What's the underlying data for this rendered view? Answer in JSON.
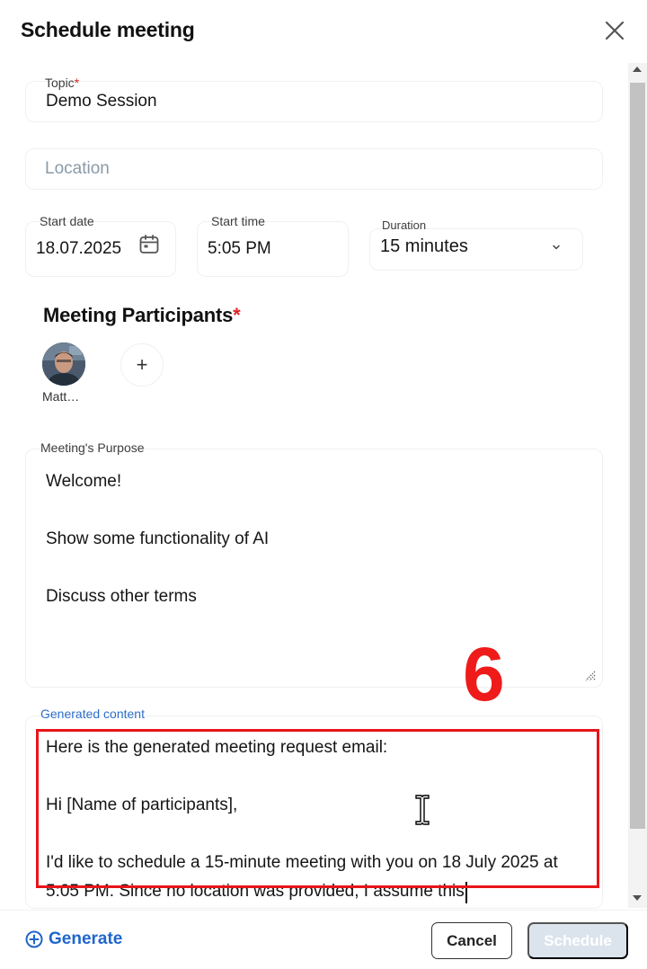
{
  "dialog": {
    "title": "Schedule meeting"
  },
  "form": {
    "topic": {
      "label": "Topic",
      "required_mark": "*",
      "value": "Demo Session"
    },
    "location": {
      "placeholder": "Location",
      "value": ""
    },
    "start_date": {
      "label": "Start date",
      "value": "18.07.2025"
    },
    "start_time": {
      "label": "Start time",
      "value": "5:05 PM"
    },
    "duration": {
      "label": "Duration",
      "value": "15 minutes"
    }
  },
  "participants": {
    "title": "Meeting Participants",
    "required_mark": "*",
    "items": [
      {
        "name": "Matt…"
      }
    ],
    "add_label": "+"
  },
  "purpose": {
    "label": "Meeting's Purpose",
    "text": "Welcome!\n\nShow some functionality of AI\n\nDiscuss other terms"
  },
  "generated": {
    "label": "Generated content",
    "text": "Here is the generated meeting request email:\n\nHi [Name of participants],\n\nI'd like to schedule a 15-minute meeting with you on 18 July 2025 at 5:05 PM. Since no location was provided, I assume this"
  },
  "annotation": {
    "step_number": "6",
    "color": "#e8141a"
  },
  "footer": {
    "generate_label": "Generate",
    "cancel_label": "Cancel",
    "schedule_label": "Schedule"
  },
  "colors": {
    "accent": "#1f66cc",
    "required": "#dd2222",
    "schedule_disabled": "#dbe4ec"
  },
  "icons": {
    "close": "close-icon",
    "calendar": "calendar-icon",
    "chevron": "chevron-down-icon",
    "resize": "resize-handle-icon",
    "generate": "plus-circle-icon",
    "cursor": "text-cursor-icon"
  }
}
